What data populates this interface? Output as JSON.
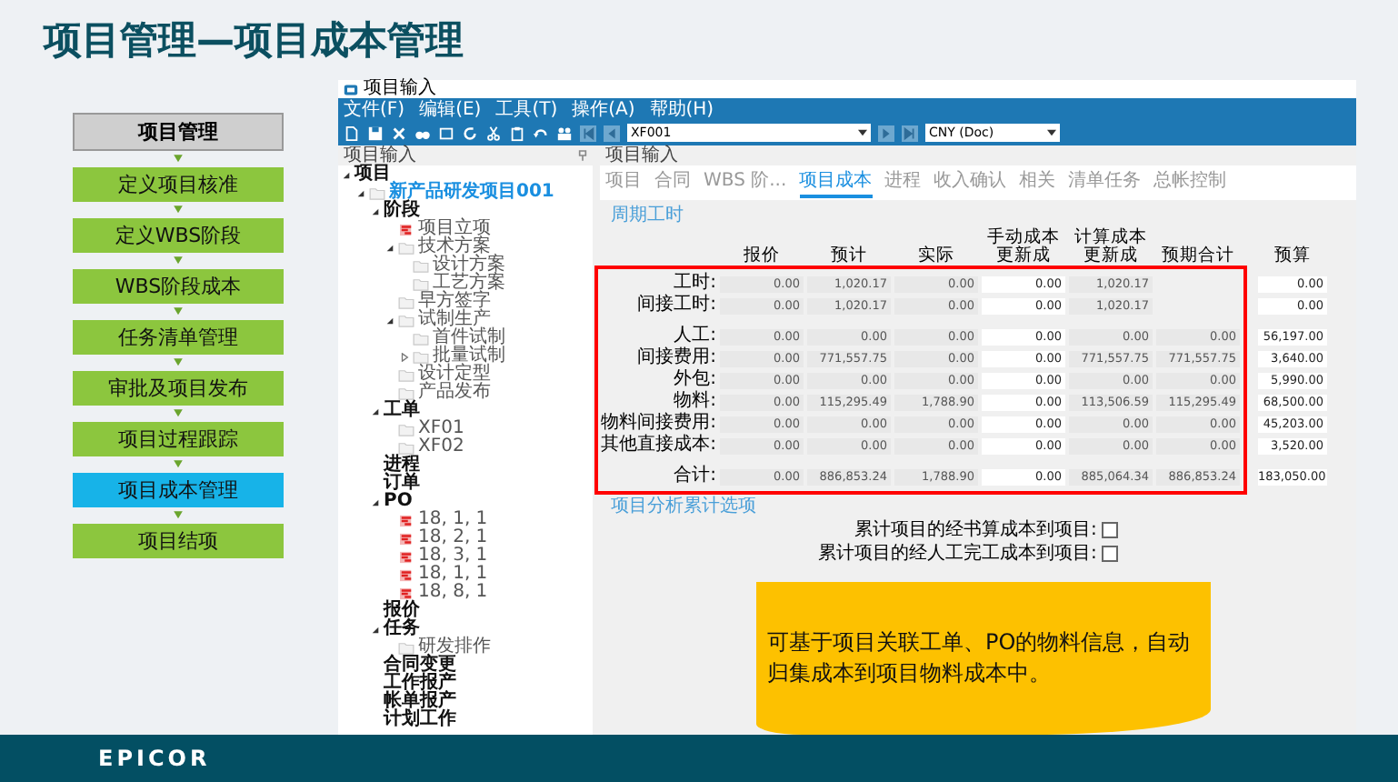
{
  "slide_title": "项目管理—项目成本管理",
  "steps": {
    "header": "项目管理",
    "items": [
      {
        "label": "定义项目核准",
        "selected": false
      },
      {
        "label": "定义WBS阶段",
        "selected": false
      },
      {
        "label": "WBS阶段成本",
        "selected": false
      },
      {
        "label": "任务清单管理",
        "selected": false
      },
      {
        "label": "审批及项目发布",
        "selected": false
      },
      {
        "label": "项目过程跟踪",
        "selected": false
      },
      {
        "label": "项目成本管理",
        "selected": true
      },
      {
        "label": "项目结项",
        "selected": false
      }
    ]
  },
  "app": {
    "title": "项目输入",
    "menu": [
      "文件(F)",
      "编辑(E)",
      "工具(T)",
      "操作(A)",
      "帮助(H)"
    ],
    "toolbar": {
      "job_field": "XF001",
      "currency_field": "CNY (Doc)"
    },
    "tree_panel": {
      "title": "项目输入",
      "tree": [
        {
          "label": "项目",
          "kind": "group",
          "expanded": true,
          "children": [
            {
              "label": "新产品研发项目001",
              "kind": "project",
              "expanded": true,
              "children": [
                {
                  "label": "阶段",
                  "kind": "group",
                  "expanded": true,
                  "children": [
                    {
                      "label": "项目立项",
                      "kind": "flag"
                    },
                    {
                      "label": "技术方案",
                      "kind": "folder",
                      "expanded": true,
                      "children": [
                        {
                          "label": "设计方案",
                          "kind": "folder"
                        },
                        {
                          "label": "工艺方案",
                          "kind": "folder"
                        }
                      ]
                    },
                    {
                      "label": "早方签字",
                      "kind": "folder"
                    },
                    {
                      "label": "试制生产",
                      "kind": "folder",
                      "expanded": true,
                      "children": [
                        {
                          "label": "首件试制",
                          "kind": "folder"
                        },
                        {
                          "label": "批量试制",
                          "kind": "folder",
                          "expanded": false
                        }
                      ]
                    },
                    {
                      "label": "设计定型",
                      "kind": "folder"
                    },
                    {
                      "label": "产品发布",
                      "kind": "folder"
                    }
                  ]
                },
                {
                  "label": "工单",
                  "kind": "group",
                  "expanded": true,
                  "children": [
                    {
                      "label": "XF01",
                      "kind": "folder"
                    },
                    {
                      "label": "XF02",
                      "kind": "folder"
                    }
                  ]
                },
                {
                  "label": "进程",
                  "kind": "group"
                },
                {
                  "label": "订单",
                  "kind": "group"
                },
                {
                  "label": "PO",
                  "kind": "group",
                  "expanded": true,
                  "children": [
                    {
                      "label": "18, 1, 1",
                      "kind": "flag"
                    },
                    {
                      "label": "18, 2, 1",
                      "kind": "flag"
                    },
                    {
                      "label": "18, 3, 1",
                      "kind": "flag"
                    },
                    {
                      "label": "18, 1, 1",
                      "kind": "flag"
                    },
                    {
                      "label": "18, 8, 1",
                      "kind": "flag"
                    }
                  ]
                },
                {
                  "label": "报价",
                  "kind": "group"
                },
                {
                  "label": "任务",
                  "kind": "group",
                  "expanded": true,
                  "children": [
                    {
                      "label": "研发排作",
                      "kind": "folder"
                    }
                  ]
                },
                {
                  "label": "合同变更",
                  "kind": "group"
                },
                {
                  "label": "工作报产",
                  "kind": "group"
                },
                {
                  "label": "帐单报产",
                  "kind": "group"
                },
                {
                  "label": "计划工作",
                  "kind": "group"
                }
              ]
            }
          ]
        }
      ]
    },
    "detail_panel": {
      "title": "项目输入",
      "tabs": [
        {
          "label": "项目",
          "selected": false
        },
        {
          "label": "合同",
          "selected": false
        },
        {
          "label": "WBS 阶...",
          "selected": false
        },
        {
          "label": "项目成本",
          "selected": true
        },
        {
          "label": "进程",
          "selected": false
        },
        {
          "label": "收入确认",
          "selected": false
        },
        {
          "label": "相关",
          "selected": false
        },
        {
          "label": "清单任务",
          "selected": false
        },
        {
          "label": "总帐控制",
          "selected": false
        }
      ],
      "section_link": "周期工时",
      "table": {
        "columns": [
          {
            "label": "报价",
            "editable": false
          },
          {
            "label": "预计",
            "editable": false
          },
          {
            "label": "实际",
            "editable": false
          },
          {
            "label": "手动成本更新成",
            "editable": true
          },
          {
            "label": "计算成本更新成",
            "editable": false
          },
          {
            "label": "预期合计",
            "editable": false
          },
          {
            "label": "预算",
            "editable": true
          }
        ],
        "row_groups": [
          [
            {
              "label": "工时:",
              "cells": [
                "0.00",
                "1,020.17",
                "0.00",
                "0.00",
                "1,020.17",
                null,
                "0.00"
              ]
            },
            {
              "label": "间接工时:",
              "cells": [
                "0.00",
                "1,020.17",
                "0.00",
                "0.00",
                "1,020.17",
                null,
                "0.00"
              ]
            }
          ],
          [
            {
              "label": "人工:",
              "cells": [
                "0.00",
                "0.00",
                "0.00",
                "0.00",
                "0.00",
                "0.00",
                "56,197.00"
              ]
            },
            {
              "label": "间接费用:",
              "cells": [
                "0.00",
                "771,557.75",
                "0.00",
                "0.00",
                "771,557.75",
                "771,557.75",
                "3,640.00"
              ]
            },
            {
              "label": "外包:",
              "cells": [
                "0.00",
                "0.00",
                "0.00",
                "0.00",
                "0.00",
                "0.00",
                "5,990.00"
              ]
            },
            {
              "label": "物料:",
              "cells": [
                "0.00",
                "115,295.49",
                "1,788.90",
                "0.00",
                "113,506.59",
                "115,295.49",
                "68,500.00"
              ]
            },
            {
              "label": "物料间接费用:",
              "cells": [
                "0.00",
                "0.00",
                "0.00",
                "0.00",
                "0.00",
                "0.00",
                "45,203.00"
              ]
            },
            {
              "label": "其他直接成本:",
              "cells": [
                "0.00",
                "0.00",
                "0.00",
                "0.00",
                "0.00",
                "0.00",
                "3,520.00"
              ]
            }
          ],
          [
            {
              "label": "合计:",
              "cells": [
                "0.00",
                "886,853.24",
                "1,788.90",
                "0.00",
                "885,064.34",
                "886,853.24",
                "183,050.00"
              ]
            }
          ]
        ]
      },
      "analysis_link": "项目分析累计选项",
      "options": [
        {
          "label": "累计项目的经书算成本到项目:",
          "checked": false
        },
        {
          "label": "累计项目的经人工完工成本到项目:",
          "checked": false
        }
      ]
    },
    "callout": "可基于项目关联工单、PO的物料信息，自动归集成本到项目物料成本中。"
  },
  "footer": {
    "logo": "EPICOR"
  }
}
